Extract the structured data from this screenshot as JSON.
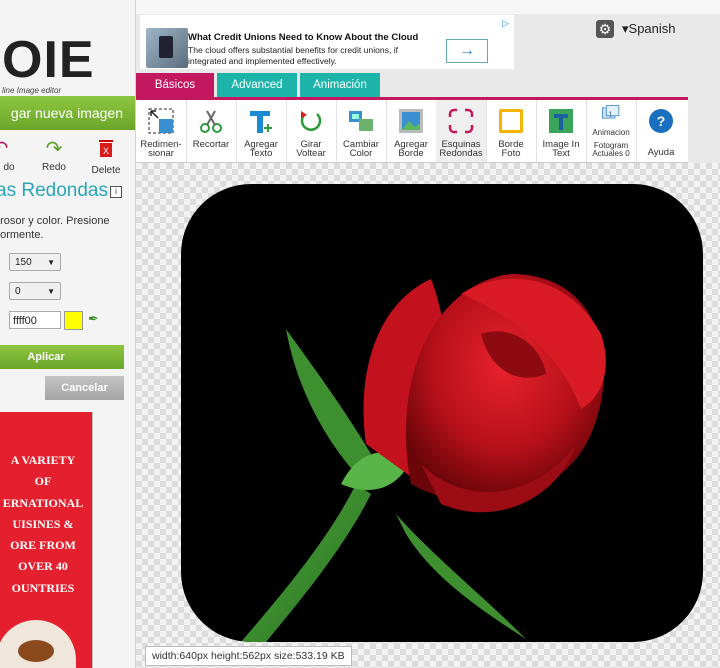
{
  "sidebar": {
    "logo_text": "OIE",
    "logo_sub": "line Image editor",
    "upload_label": "gar nueva imagen",
    "undo_label": "do",
    "redo_label": "Redo",
    "delete_label": "Delete",
    "panel_title": "as Redondas",
    "panel_desc": "grosor y color. Presione\nriormente.",
    "size_value": "150",
    "radius_value": "0",
    "color_value": "ffff00",
    "apply_label": "Aplicar",
    "cancel_label": "Cancelar",
    "ad_text": "A VARIETY\nOF\nERNATIONAL\nUISINES &\nORE FROM\nOVER 40\nOUNTRIES"
  },
  "ad": {
    "title": "What Credit Unions Need to Know About the Cloud",
    "body": "The cloud offers substantial benefits for credit unions, if integrated and implemented effectively.",
    "cta": "→"
  },
  "header": {
    "language": "▾Spanish"
  },
  "tabs": [
    {
      "label": "Básicos"
    },
    {
      "label": "Advanced"
    },
    {
      "label": "Animación"
    }
  ],
  "tools": [
    {
      "label": "Redimen-\nsionar"
    },
    {
      "label": "Recortar"
    },
    {
      "label": "Agregar\nTexto"
    },
    {
      "label": "Girar\nVoltear"
    },
    {
      "label": "Cambiar\nColor"
    },
    {
      "label": "Agregar\nBorde"
    },
    {
      "label": "Esquinas\nRedondas"
    },
    {
      "label": "Borde\nFoto"
    },
    {
      "label": "Image In\nText"
    },
    {
      "label": "Animacion",
      "sub": "Fotogram\nActuales 0"
    },
    {
      "label": "Ayuda"
    }
  ],
  "canvas": {
    "info": "width:640px  height:562px  size:533.19 KB"
  },
  "colors": {
    "accent_pink": "#c3185f",
    "accent_teal": "#1db5aa",
    "green": "#7ab833"
  }
}
